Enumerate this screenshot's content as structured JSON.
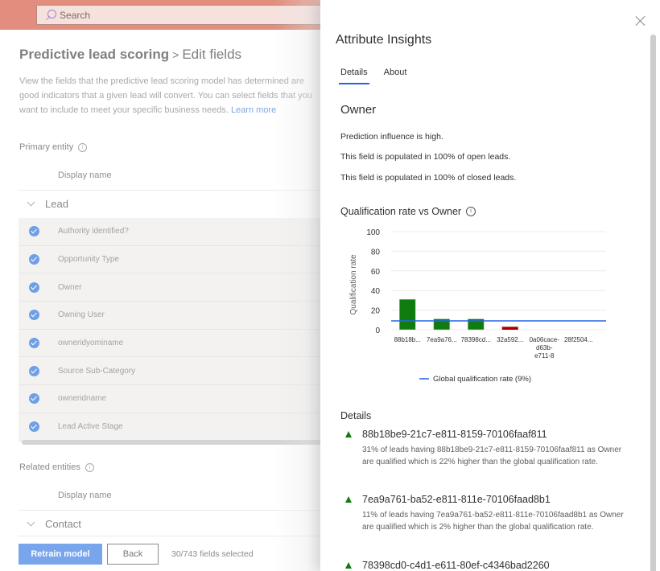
{
  "topbar": {
    "search_placeholder": "Search"
  },
  "page": {
    "title_main": "Predictive lead scoring",
    "title_sep": ">",
    "title_sub": "Edit fields",
    "description": "View the fields that the predictive lead scoring model has determined are good indicators that a given lead will convert. You can select fields that you want to include to meet your specific business needs.",
    "learn_more": "Learn more",
    "primary_entity_label": "Primary entity",
    "column_header": "Display name",
    "primary_group": "Lead",
    "fields": [
      "Authority identified?",
      "Opportunity Type",
      "Owner",
      "Owning User",
      "owneridyominame",
      "Source Sub-Category",
      "owneridname",
      "Lead Active Stage"
    ],
    "related_entities_label": "Related entities",
    "related_column_header": "Display name",
    "related_group": "Contact",
    "retrain_label": "Retrain model",
    "back_label": "Back",
    "selected_count": "30/743 fields selected"
  },
  "panel": {
    "title": "Attribute Insights",
    "tabs": [
      {
        "label": "Details",
        "active": true
      },
      {
        "label": "About",
        "active": false
      }
    ],
    "attribute": "Owner",
    "influence": "Prediction influence is high.",
    "open_pop": "This field is populated in 100% of open leads.",
    "closed_pop": "This field is populated in 100% of closed leads.",
    "chart_title": "Qualification rate vs Owner",
    "details_title": "Details",
    "details": [
      {
        "trend": "up",
        "name": "88b18be9-21c7-e811-8159-70106faaf811",
        "text": "31% of leads having 88b18be9-21c7-e811-8159-70106faaf811 as Owner are qualified which is 22% higher than the global qualification rate."
      },
      {
        "trend": "up",
        "name": "7ea9a761-ba52-e811-811e-70106faad8b1",
        "text": "11% of leads having 7ea9a761-ba52-e811-811e-70106faad8b1 as Owner are qualified which is 2% higher than the global qualification rate."
      },
      {
        "trend": "up",
        "name": "78398cd0-c4d1-e611-80ef-c4346bad2260",
        "text": ""
      }
    ]
  },
  "colors": {
    "positive": "#107c10",
    "negative": "#a80000",
    "global_line": "#2266e3",
    "accent": "#2266e3"
  },
  "chart_data": {
    "type": "bar",
    "title": "Qualification rate vs Owner",
    "xlabel": "",
    "ylabel": "Qualification rate",
    "ylim": [
      0,
      100
    ],
    "yticks": [
      0,
      20,
      40,
      60,
      80,
      100
    ],
    "grid": true,
    "categories": [
      "88b18b...",
      "7ea9a76...",
      "78398cd...",
      "32a592...",
      "0a06cace-d63b-e711-8",
      "28f2504..."
    ],
    "category_label_lines": [
      [
        "88b18b..."
      ],
      [
        "7ea9a76..."
      ],
      [
        "78398cd..."
      ],
      [
        "32a592..."
      ],
      [
        "0a06cace-",
        "d63b-",
        "e711-8"
      ],
      [
        "28f2504..."
      ]
    ],
    "values": [
      31,
      11,
      11,
      3,
      0,
      0
    ],
    "bar_colors": [
      "#107c10",
      "#107c10",
      "#107c10",
      "#a80000",
      "#107c10",
      "#107c10"
    ],
    "reference_line": {
      "name": "Global qualification rate (9%)",
      "value": 9
    },
    "legend": {
      "position": "bottom",
      "entries": [
        "Global qualification rate (9%)"
      ]
    }
  }
}
